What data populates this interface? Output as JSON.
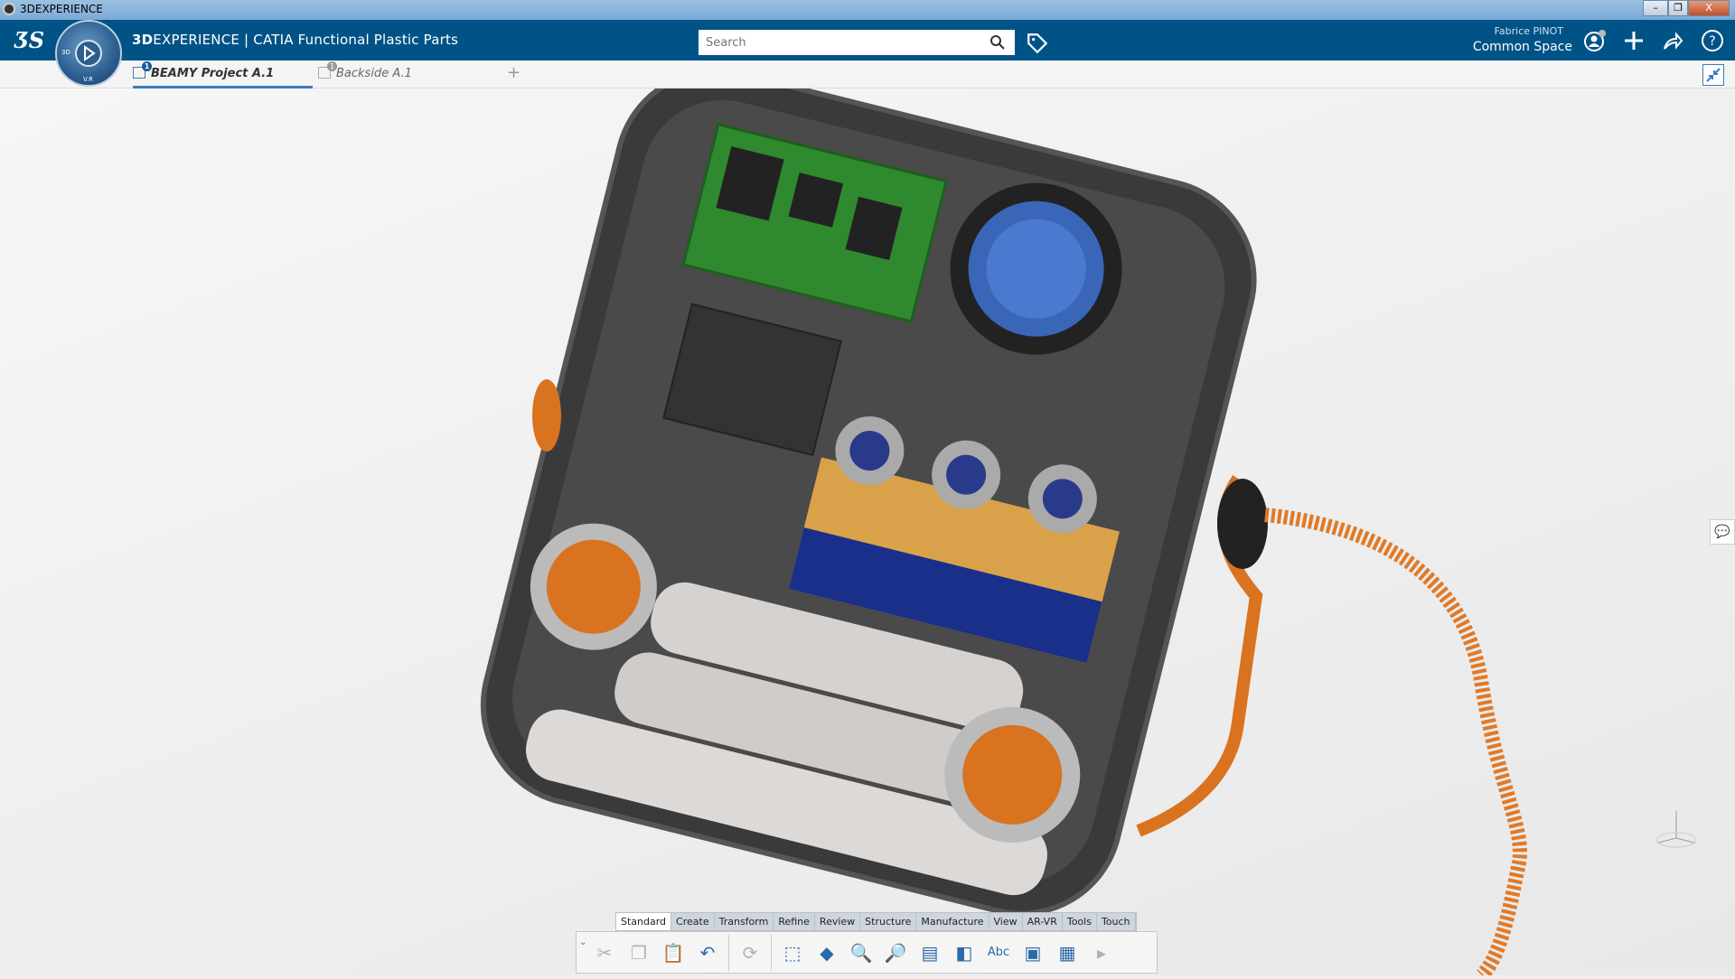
{
  "window": {
    "title": "3DEXPERIENCE",
    "minimize": "–",
    "restore": "❐",
    "close": "X"
  },
  "header": {
    "brand": "3D",
    "brand_rest": "EXPERIENCE",
    "separator": "|",
    "app": "CATIA Functional Plastic Parts",
    "search_placeholder": "Search",
    "user": "Fabrice  PINOT",
    "space": "Common Space ⌄"
  },
  "compass": {
    "labels": [
      "3D",
      "V.R"
    ]
  },
  "tabs": [
    {
      "label": "BEAMY Project A.1",
      "badge": "1",
      "active": true
    },
    {
      "label": "Backside A.1",
      "badge": "1",
      "active": false
    }
  ],
  "add_tab": "+",
  "action_bar": {
    "tabs": [
      "Standard",
      "Create",
      "Transform",
      "Refine",
      "Review",
      "Structure",
      "Manufacture",
      "View",
      "AR-VR",
      "Tools",
      "Touch"
    ],
    "active": "Standard",
    "icons": [
      {
        "name": "cut",
        "glyph": "✂",
        "enabled": false
      },
      {
        "name": "copy",
        "glyph": "❐",
        "enabled": false
      },
      {
        "name": "paste",
        "glyph": "📋",
        "enabled": false
      },
      {
        "name": "undo",
        "glyph": "↶",
        "enabled": true
      },
      {
        "name": "update",
        "glyph": "⟳",
        "enabled": false
      },
      {
        "name": "measure",
        "glyph": "⬚",
        "enabled": true
      },
      {
        "name": "surface",
        "glyph": "◆",
        "enabled": true
      },
      {
        "name": "zoom-inspect",
        "glyph": "🔍",
        "enabled": true
      },
      {
        "name": "section-inspect",
        "glyph": "🔎",
        "enabled": true
      },
      {
        "name": "tree-inspect",
        "glyph": "▤",
        "enabled": true
      },
      {
        "name": "thickness",
        "glyph": "◧",
        "enabled": true
      },
      {
        "name": "annotation",
        "glyph": "Abc",
        "enabled": true
      },
      {
        "name": "capture",
        "glyph": "▣",
        "enabled": true
      },
      {
        "name": "structure",
        "glyph": "▦",
        "enabled": true
      }
    ]
  },
  "colors": {
    "header": "#005386",
    "accent": "#3a7ac0",
    "orange": "#d9731f"
  }
}
